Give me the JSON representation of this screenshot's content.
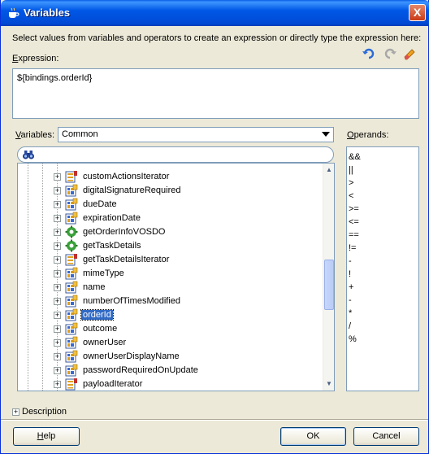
{
  "window": {
    "title": "Variables",
    "close_label": "X"
  },
  "instruction": "Select values from variables and operators to create an expression or directly type the expression here:",
  "expression": {
    "label_key": "E",
    "label_rest": "xpression:",
    "value": "${bindings.orderId}"
  },
  "toolbar": {
    "undo_icon": "undo-icon",
    "redo_icon": "redo-icon",
    "clear_icon": "eraser-icon"
  },
  "variables": {
    "label_key": "V",
    "label_rest": "ariables:",
    "selected": "Common"
  },
  "operands": {
    "label_key": "O",
    "label_rest": "perands:",
    "items": [
      "&&",
      "||",
      ">",
      "<",
      ">=",
      "<=",
      "==",
      "!=",
      "-",
      "!",
      "+",
      "-",
      "*",
      "/",
      "%"
    ]
  },
  "tree": {
    "items": [
      {
        "label": "customActionsIterator",
        "icon": "iterator-icon"
      },
      {
        "label": "digitalSignatureRequired",
        "icon": "attribute-icon"
      },
      {
        "label": "dueDate",
        "icon": "attribute-icon"
      },
      {
        "label": "expirationDate",
        "icon": "attribute-icon"
      },
      {
        "label": "getOrderInfoVOSDO",
        "icon": "method-icon"
      },
      {
        "label": "getTaskDetails",
        "icon": "method-icon"
      },
      {
        "label": "getTaskDetailsIterator",
        "icon": "iterator-icon"
      },
      {
        "label": "mimeType",
        "icon": "attribute-icon"
      },
      {
        "label": "name",
        "icon": "attribute-icon"
      },
      {
        "label": "numberOfTimesModified",
        "icon": "attribute-icon"
      },
      {
        "label": "orderId",
        "icon": "attribute-icon",
        "selected": true
      },
      {
        "label": "outcome",
        "icon": "attribute-icon"
      },
      {
        "label": "ownerUser",
        "icon": "attribute-icon"
      },
      {
        "label": "ownerUserDisplayName",
        "icon": "attribute-icon"
      },
      {
        "label": "passwordRequiredOnUpdate",
        "icon": "attribute-icon"
      },
      {
        "label": "payloadIterator",
        "icon": "iterator-icon"
      }
    ]
  },
  "description": {
    "label": "Description"
  },
  "buttons": {
    "help_key": "H",
    "help_rest": "elp",
    "ok": "OK",
    "cancel": "Cancel"
  }
}
